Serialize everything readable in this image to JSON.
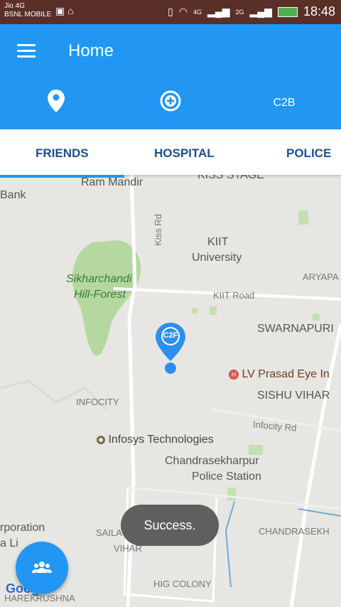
{
  "status_bar": {
    "carrier_line1": "Jio 4G",
    "carrier_line2": "BSNL MOBILE",
    "net1": "4G",
    "net2": "2G",
    "time": "18:48"
  },
  "app_bar": {
    "title": "Home",
    "c2b_label": "C2B"
  },
  "tabs": {
    "friends": "FRIENDS",
    "hospital": "HOSPITAL",
    "police": "POLICE"
  },
  "map": {
    "marker_label": "C2F",
    "places": {
      "bank": "Bank",
      "ram_mandir": "Ram Mandir",
      "kiss_stage": "KISS STAGE",
      "kiss_rd": "Kiss Rd",
      "kiit_univ_1": "KIIT",
      "kiit_univ_2": "University",
      "aryapalli": "ARYAPA",
      "forest_1": "Sikharchandi",
      "forest_2": "Hill-Forest",
      "kiit_road": "KIIT Road",
      "swarnapuri": "SWARNAPURI",
      "lv_prasad": "LV Prasad Eye In",
      "sishu_vihar": "SISHU VIHAR",
      "infocity": "INFOCITY",
      "infocity_rd": "Infocity Rd",
      "infosys": "Infosys Technologies",
      "police_1": "Chandrasekharpur",
      "police_2": "Police Station",
      "corp_1": "rporation",
      "corp_2": "a Li",
      "saila_1": "SAILA",
      "saila_2": "VIHAR",
      "chandrasekh": "CHANDRASEKH",
      "hig_colony": "HIG COLONY",
      "harekrushna": "HAREKRUSHNA"
    }
  },
  "toast": "Success.",
  "google_logo": "Google",
  "colors": {
    "primary": "#2196f3",
    "tab_text": "#1e4f86",
    "status_bar": "#5a2f28",
    "map_bg": "#e8e6e2",
    "park_green": "#b5d8a0",
    "marker_blue": "#2a8ff0"
  }
}
